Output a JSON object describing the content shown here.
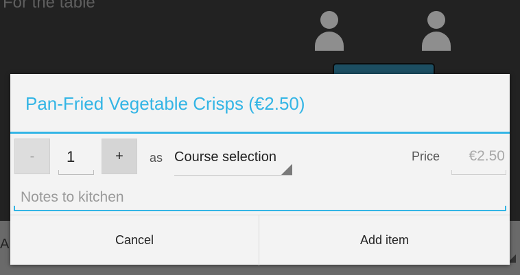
{
  "background": {
    "section_label": "For the table",
    "bar_letter": "A"
  },
  "dialog": {
    "title": "Pan-Fried Vegetable Crisps (€2.50)",
    "quantity": {
      "minus_label": "-",
      "value": "1",
      "plus_label": "+"
    },
    "as_label": "as",
    "course_selection": "Course selection",
    "price_label": "Price",
    "price_value": "€2.50",
    "notes_placeholder": "Notes to kitchen",
    "cancel_label": "Cancel",
    "add_item_label": "Add item"
  },
  "colors": {
    "accent": "#33b5e5",
    "dialog_background": "#f3f3f3",
    "app_background": "#222222"
  },
  "icons": [
    "person-icon",
    "dropdown-corner-icon"
  ]
}
